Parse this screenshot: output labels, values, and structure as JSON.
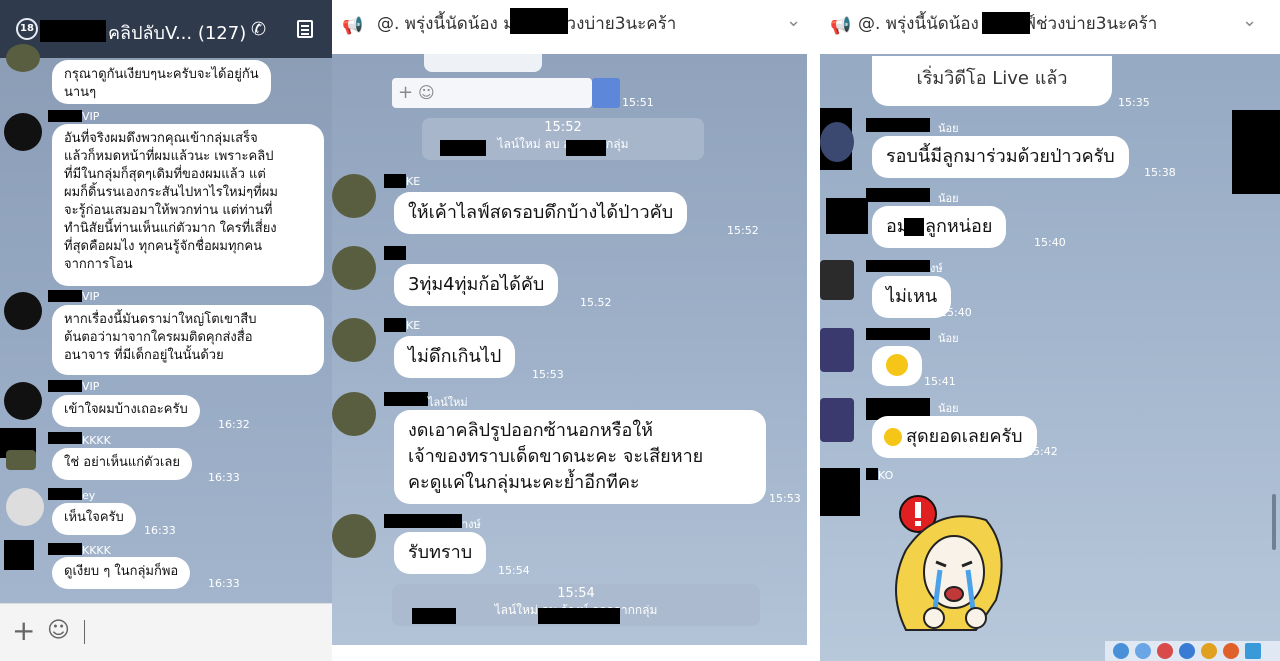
{
  "panel1": {
    "header": {
      "badge": "18",
      "title": "คลิปลับV... (127)",
      "call_icon": "phone-icon",
      "menu_icon": "menu-icon"
    },
    "messages": [
      {
        "sender": "",
        "text_lines": [
          "กรุณาดูกันเงียบๆนะครับจะได้อยู่กัน",
          "นานๆ"
        ],
        "time": ""
      },
      {
        "sender": "VIP",
        "text_lines": [
          "อันที่จริงผมดึงพวกคุณเข้ากลุ่มเสร็จ",
          "แล้วก็หมดหน้าที่ผมแล้วนะ เพราะคลิป",
          "ที่มีในกลุ่มก็สุดๆเดิมที่ของผมแล้ว แต่",
          "ผมก็ดิ้นรนเองกระสันไปหาไรใหม่ๆที่ผม",
          "จะรู้ก่อนเสมอมาให้พวกท่าน แต่ท่านที่",
          "ทำนิสัยนี้ท่านเห็นแก่ตัวมาก ใครที่เสี่ยง",
          "ที่สุดคือผมไง ทุกคนรู้จักชื่อผมทุกคน",
          "จากการโอน"
        ],
        "time": ""
      },
      {
        "sender": "VIP",
        "text_lines": [
          "หากเรื่องนี้มันดราม่าใหญ่โตเขาสืบ",
          "ต้นตอว่ามาจากใครผมติดคุกส่งสื่อ",
          "อนาจาร ที่มีเด็กอยู่ในนั้นด้วย"
        ],
        "time": ""
      },
      {
        "sender": "VIP",
        "text_lines": [
          "เข้าใจผมบ้างเถอะครับ"
        ],
        "time": "16:32"
      },
      {
        "sender": "KKKK",
        "text_lines": [
          "ใช่ อย่าเห็นแก่ตัวเลย"
        ],
        "time": "16:33"
      },
      {
        "sender": "ey",
        "text_lines": [
          "เห็นใจครับ"
        ],
        "time": "16:33"
      },
      {
        "sender": "KKKK",
        "text_lines": [
          "ดูเงียบ ๆ ในกลุ่มก็พอ"
        ],
        "time": "16:33"
      }
    ],
    "input": {
      "plus_icon": "plus-icon",
      "emoji_icon": "smile-icon"
    }
  },
  "panel2": {
    "header": {
      "title": "@. พรุ่งนี้นัดน้อง        มาไลฟ์ช่วงบ่าย3นะคร้า",
      "megaphone_icon": "megaphone-icon",
      "chevron_icon": "chevron-down-icon"
    },
    "top_time": "15:51",
    "system1": {
      "time": "15:52",
      "text": "ไลน์ใหม่ ลบ        ออกจากกลุ่ม"
    },
    "messages": [
      {
        "sender": "KE",
        "text_lines": [
          "ให้เค้าไลฟ์สดรอบดึกบ้างได้ป่าวคับ"
        ],
        "time": "15:52"
      },
      {
        "sender": "",
        "text_lines": [
          "3ทุ่ม4ทุ่มก้อได้คับ"
        ],
        "time": "15.52"
      },
      {
        "sender": "KE",
        "text_lines": [
          "ไม่ดึกเกินไป"
        ],
        "time": "15:53"
      },
      {
        "sender": "ไลน์ใหม่",
        "text_lines": [
          "งดเอาคลิปรูปออกซ้านอกหรือให้",
          "เจ้าของทราบเด็ดขาดนะคะ จะเสียหาย",
          "คะดูแค่ในกลุ่มนะคะย้ำอีกทีคะ"
        ],
        "time": "15:53"
      },
      {
        "sender": "างษ์",
        "text_lines": [
          "รับทราบ"
        ],
        "time": "15:54"
      }
    ],
    "system2": {
      "time": "15:54",
      "text": "ไลน์ใหม่ ลบ        ล้างษ์ ออกจากกลุ่ม"
    }
  },
  "panel3": {
    "header": {
      "title": "@. พรุ่งนี้นัดน้อง        มาไลฟ์ช่วงบ่าย3นะคร้า",
      "megaphone_icon": "megaphone-icon",
      "chevron_icon": "chevron-down-icon"
    },
    "messages": [
      {
        "sender": "",
        "text_lines": [
          "เริ่มวิดีโอ Live แล้ว"
        ],
        "time": "15:35"
      },
      {
        "sender": "น้อย",
        "text_lines": [
          "รอบนี้มีลูกมาร่วมด้วยป่าวครับ"
        ],
        "time": "15:38"
      },
      {
        "sender": "น้อย",
        "text_lines": [
          "อม    ยลูกหน่อย"
        ],
        "time": "15:40"
      },
      {
        "sender": "งษ์",
        "text_lines": [
          "ไม่เหน"
        ],
        "time": "15:40"
      },
      {
        "sender": "น้อย",
        "text_lines": [
          ""
        ],
        "time": "15:41"
      },
      {
        "sender": "น้อย",
        "text_lines": [
          "สุดยอดเลยครับ"
        ],
        "time": "15:42"
      },
      {
        "sender": "KO",
        "text_lines": [
          ""
        ],
        "time": ""
      }
    ]
  }
}
